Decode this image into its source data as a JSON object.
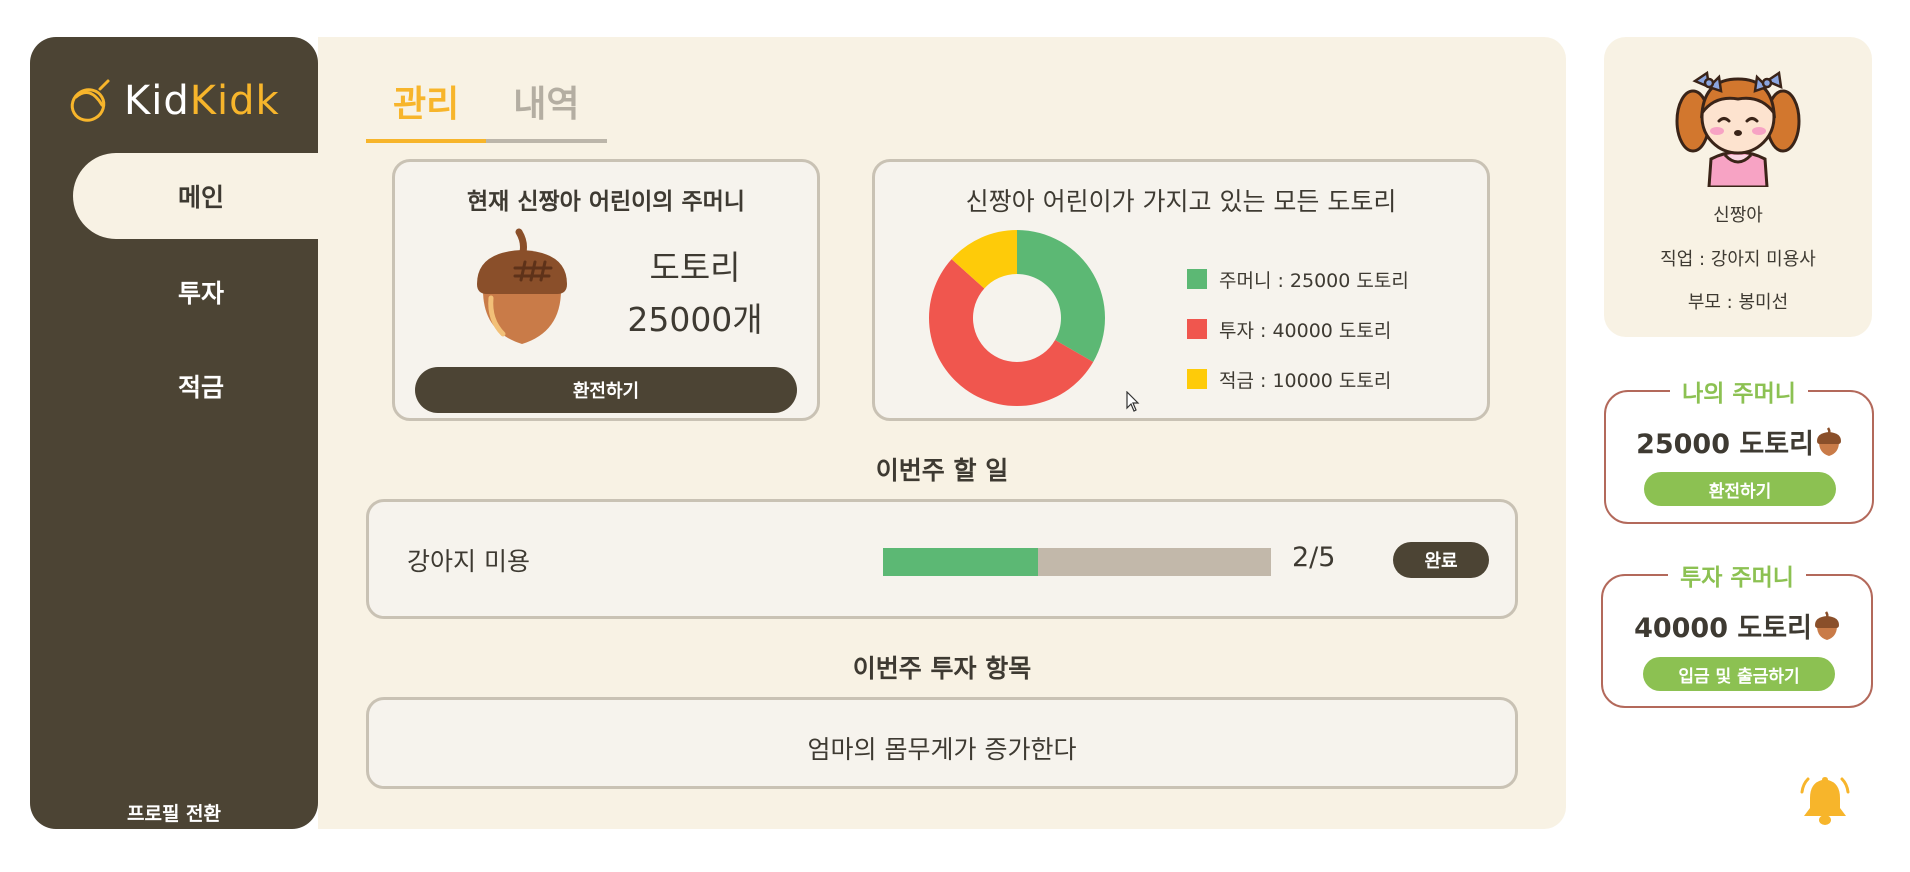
{
  "brand": {
    "name_part1": "Kid",
    "name_part2": "Kidk"
  },
  "sidebar": {
    "items": [
      {
        "label": "메인",
        "active": true
      },
      {
        "label": "투자",
        "active": false
      },
      {
        "label": "적금",
        "active": false
      }
    ],
    "profile_switch": "프로필 전환"
  },
  "tabs": [
    {
      "label": "관리",
      "active": true
    },
    {
      "label": "내역",
      "active": false
    }
  ],
  "pouch": {
    "title": "현재 신짱아 어린이의 주머니",
    "unit_label": "도토리",
    "amount": "25000개",
    "button": "환전하기"
  },
  "chart_card": {
    "title": "신짱아 어린이가 가지고 있는 모든 도토리"
  },
  "chart_data": {
    "type": "pie",
    "donut": true,
    "categories": [
      "주머니",
      "투자",
      "적금"
    ],
    "values": [
      25000,
      40000,
      10000
    ],
    "colors": [
      "#5cb874",
      "#f0564e",
      "#fecb09"
    ],
    "legend_labels": [
      "주머니 : 25000 도토리",
      "투자 : 40000 도토리",
      "적금 : 10000 도토리"
    ],
    "legend_position": "right"
  },
  "todo": {
    "section_title": "이번주 할 일",
    "label": "강아지 미용",
    "progress_done": 2,
    "progress_total": 5,
    "count_text": "2/5",
    "button": "완료"
  },
  "invest_section": {
    "title": "이번주 투자 항목",
    "item": "엄마의 몸무게가 증가한다"
  },
  "profile": {
    "name": "신짱아",
    "job": "직업 : 강아지 미용사",
    "parent": "부모 : 봉미선"
  },
  "wallets": {
    "my": {
      "title": "나의 주머니",
      "amount": "25000 도토리",
      "button": "환전하기"
    },
    "invest": {
      "title": "투자 주머니",
      "amount": "40000 도토리",
      "button": "입금 및 출금하기"
    }
  },
  "icons": {
    "logo": "acorn-outline-icon",
    "pouch": "acorn-icon",
    "wallet": "acorn-icon",
    "notification": "bell-icon"
  },
  "colors": {
    "sidebar": "#4c4434",
    "panel": "#f8f2e4",
    "accent": "#f7b52b",
    "green": "#8cc152",
    "wallet_border": "#b3695b"
  }
}
